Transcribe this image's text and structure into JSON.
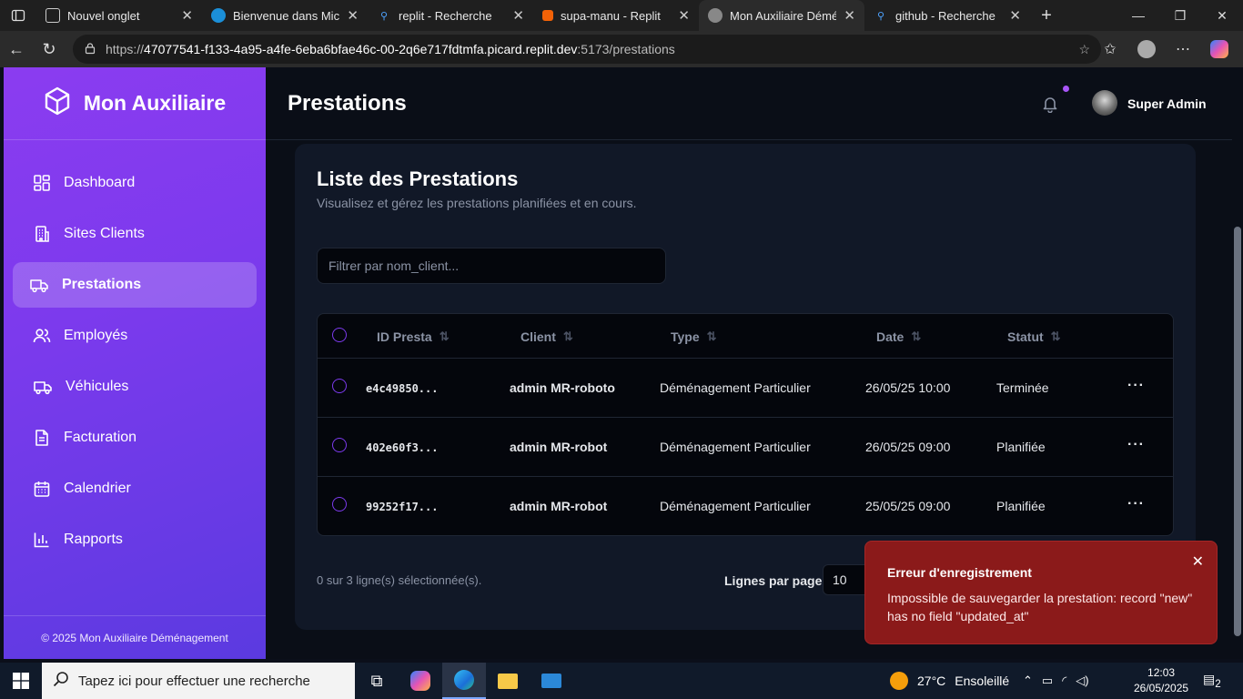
{
  "browser": {
    "tabs": [
      {
        "title": "Nouvel onglet"
      },
      {
        "title": "Bienvenue dans Microsoft Edge"
      },
      {
        "title": "replit - Recherche"
      },
      {
        "title": "supa-manu - Replit"
      },
      {
        "title": "Mon Auxiliaire Déménagement"
      },
      {
        "title": "github - Recherche"
      }
    ],
    "url_prefix": "https://",
    "url_host": "47077541-f133-4a95-a4fe-6eba6bfae46c-00-2q6e717fdtmfa.picard.replit.dev",
    "url_path": ":5173/prestations"
  },
  "sidebar": {
    "brand": "Mon Auxiliaire",
    "items": [
      {
        "label": "Dashboard",
        "icon": "dashboard-icon"
      },
      {
        "label": "Sites Clients",
        "icon": "building-icon"
      },
      {
        "label": "Prestations",
        "icon": "truck-icon",
        "active": true
      },
      {
        "label": "Employés",
        "icon": "users-icon"
      },
      {
        "label": "Véhicules",
        "icon": "truck-icon"
      },
      {
        "label": "Facturation",
        "icon": "file-icon"
      },
      {
        "label": "Calendrier",
        "icon": "calendar-icon"
      },
      {
        "label": "Rapports",
        "icon": "chart-icon"
      }
    ],
    "footer": "© 2025 Mon Auxiliaire Déménagement"
  },
  "header": {
    "title": "Prestations",
    "user_name": "Super Admin"
  },
  "card": {
    "title": "Liste des Prestations",
    "subtitle": "Visualisez et gérez les prestations planifiées et en cours.",
    "filter_placeholder": "Filtrer par nom_client..."
  },
  "table": {
    "columns": [
      "ID Presta",
      "Client",
      "Type",
      "Date",
      "Statut"
    ],
    "rows": [
      {
        "id": "e4c49850...",
        "client": "admin MR-roboto",
        "type": "Déménagement Particulier",
        "date": "26/05/25 10:00",
        "status": "Terminée"
      },
      {
        "id": "402e60f3...",
        "client": "admin MR-robot",
        "type": "Déménagement Particulier",
        "date": "26/05/25 09:00",
        "status": "Planifiée"
      },
      {
        "id": "99252f17...",
        "client": "admin MR-robot",
        "type": "Déménagement Particulier",
        "date": "25/05/25 09:00",
        "status": "Planifiée"
      }
    ]
  },
  "footer": {
    "selection": "0 sur 3 ligne(s) sélectionnée(s).",
    "rows_per_page_label": "Lignes par page",
    "rows_per_page_value": "10"
  },
  "toast": {
    "title": "Erreur d'enregistrement",
    "message": "Impossible de sauvegarder la prestation: record \"new\" has no field \"updated_at\""
  },
  "taskbar": {
    "search_placeholder": "Tapez ici pour effectuer une recherche",
    "weather_temp": "27°C",
    "weather_text": "Ensoleillé",
    "time": "12:03",
    "date": "26/05/2025",
    "notifications": "2"
  },
  "colors": {
    "accent": "#7c3aed",
    "toast_bg": "#8b1a1a",
    "main_bg": "#0a0e17"
  }
}
